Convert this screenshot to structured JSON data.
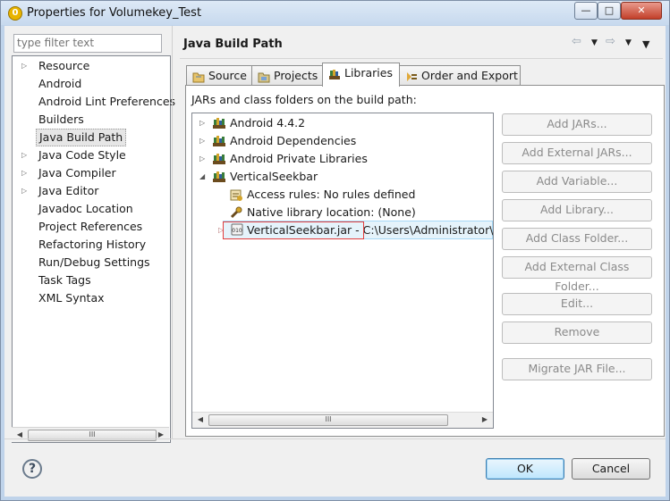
{
  "window": {
    "title": "Properties for Volumekey_Test",
    "app_icon_glyph": "0",
    "minimize_glyph": "—",
    "maximize_glyph": "□",
    "close_glyph": "✕"
  },
  "filter": {
    "placeholder": "type filter text"
  },
  "nav": {
    "items": [
      {
        "label": "Resource",
        "expandable": true
      },
      {
        "label": "Android",
        "expandable": false
      },
      {
        "label": "Android Lint Preferences",
        "expandable": false
      },
      {
        "label": "Builders",
        "expandable": false
      },
      {
        "label": "Java Build Path",
        "expandable": false,
        "selected": true
      },
      {
        "label": "Java Code Style",
        "expandable": true
      },
      {
        "label": "Java Compiler",
        "expandable": true
      },
      {
        "label": "Java Editor",
        "expandable": true
      },
      {
        "label": "Javadoc Location",
        "expandable": false
      },
      {
        "label": "Project References",
        "expandable": false
      },
      {
        "label": "Refactoring History",
        "expandable": false
      },
      {
        "label": "Run/Debug Settings",
        "expandable": false
      },
      {
        "label": "Task Tags",
        "expandable": false
      },
      {
        "label": "XML Syntax",
        "expandable": false
      }
    ],
    "scroll_thumb_glyph": "III"
  },
  "page": {
    "title": "Java Build Path",
    "back_glyph": "⇦",
    "forward_glyph": "⇨",
    "dropdown_glyph": "▼"
  },
  "tabs": [
    {
      "label": "Source",
      "icon": "source-folder-icon"
    },
    {
      "label": "Projects",
      "icon": "projects-icon"
    },
    {
      "label": "Libraries",
      "icon": "libraries-icon",
      "active": true
    },
    {
      "label": "Order and Export",
      "icon": "order-export-icon"
    }
  ],
  "libraries": {
    "description": "JARs and class folders on the build path:",
    "tree": [
      {
        "label": "Android 4.4.2",
        "level": 0,
        "state": "collapsed",
        "icon": "library-icon"
      },
      {
        "label": "Android Dependencies",
        "level": 0,
        "state": "collapsed",
        "icon": "library-icon"
      },
      {
        "label": "Android Private Libraries",
        "level": 0,
        "state": "collapsed",
        "icon": "library-icon"
      },
      {
        "label": "VerticalSeekbar",
        "level": 0,
        "state": "expanded",
        "icon": "library-icon"
      },
      {
        "label": "Access rules: No rules defined",
        "level": 1,
        "state": "leaf",
        "icon": "access-rules-icon"
      },
      {
        "label": "Native library location: (None)",
        "level": 1,
        "state": "leaf",
        "icon": "native-library-icon"
      },
      {
        "label": "VerticalSeekbar.jar - C:\\Users\\Administrator\\Desktop",
        "level": 1,
        "state": "collapsed",
        "icon": "jar-icon",
        "selected": true
      }
    ],
    "scroll_thumb_glyph": "III"
  },
  "actions": [
    {
      "label": "Add JARs...",
      "enabled": false
    },
    {
      "label": "Add External JARs...",
      "enabled": false
    },
    {
      "label": "Add Variable...",
      "enabled": false
    },
    {
      "label": "Add Library...",
      "enabled": false
    },
    {
      "label": "Add Class Folder...",
      "enabled": false
    },
    {
      "label": "Add External Class Folder...",
      "enabled": false
    },
    {
      "label": "Edit...",
      "enabled": false
    },
    {
      "label": "Remove",
      "enabled": false
    },
    {
      "label": "Migrate JAR File...",
      "enabled": false
    }
  ],
  "footer": {
    "help_glyph": "?",
    "ok_label": "OK",
    "cancel_label": "Cancel"
  },
  "colors": {
    "selection_bg": "#e5f3fb",
    "highlight_border": "#e23e3e",
    "titlebar": "#c7d9ee"
  }
}
